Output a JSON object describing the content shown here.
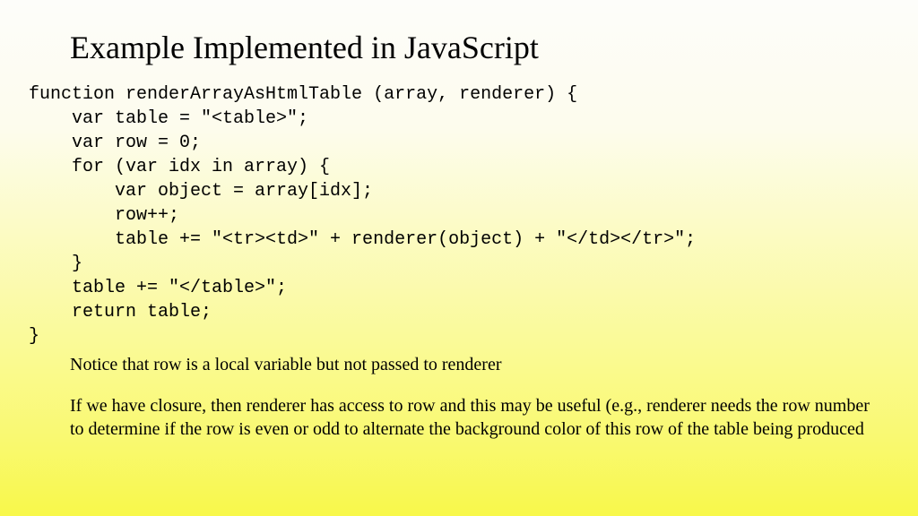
{
  "title": "Example Implemented in JavaScript",
  "code": "function renderArrayAsHtmlTable (array, renderer) {\n    var table = \"<table>\";\n    var row = 0;\n    for (var idx in array) {\n        var object = array[idx];\n        row++;\n        table += \"<tr><td>\" + renderer(object) + \"</td></tr>\";\n    }\n    table += \"</table>\";\n    return table;\n}",
  "note1": "Notice that row is a local variable but not passed to renderer",
  "note2": "If we have closure, then renderer has access to row and this may be useful (e.g., renderer needs the row number to determine if the row is even or odd to alternate the background color of this row of the table being produced"
}
